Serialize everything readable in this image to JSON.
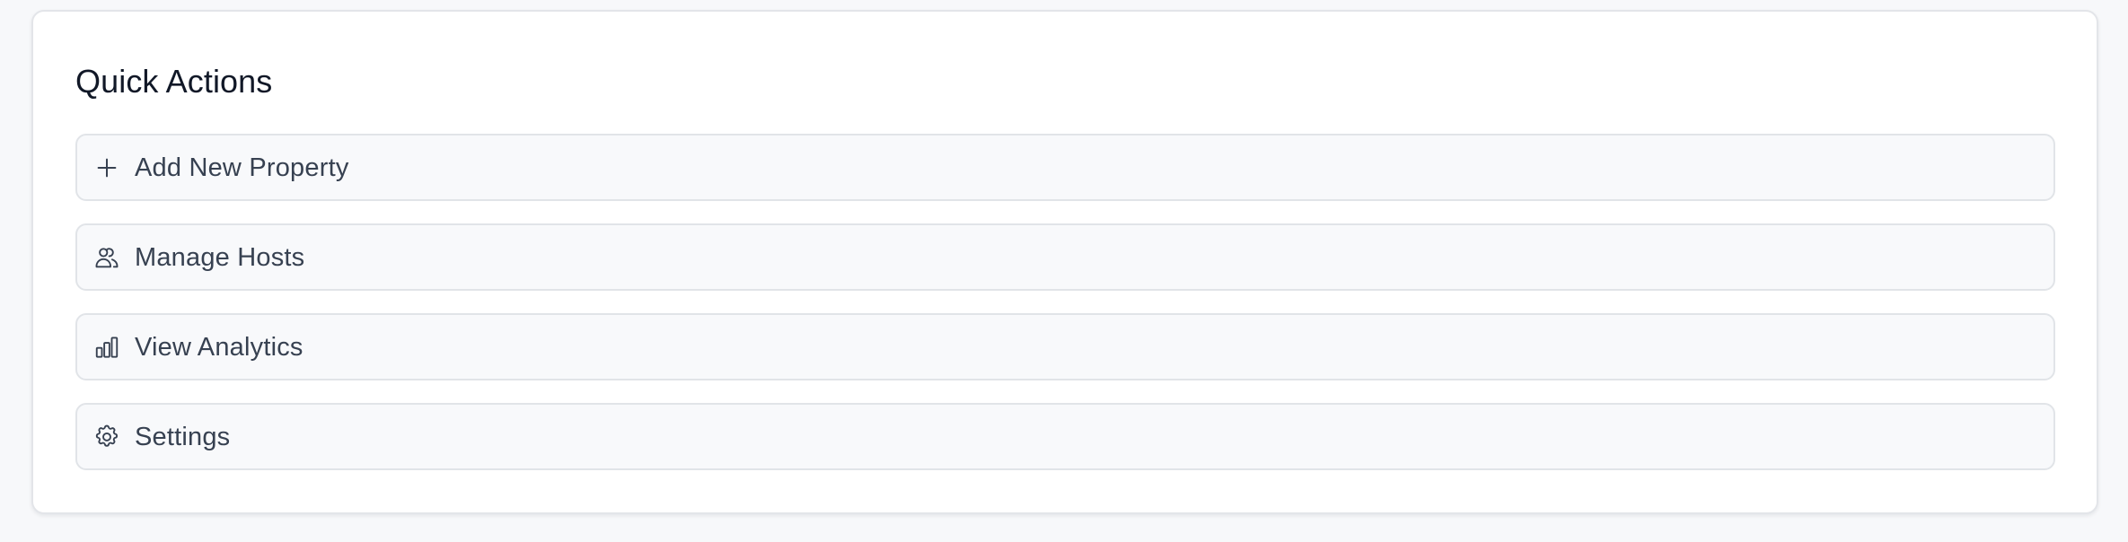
{
  "quick_actions": {
    "title": "Quick Actions",
    "items": [
      {
        "label": "Add New Property",
        "icon": "plus-icon"
      },
      {
        "label": "Manage Hosts",
        "icon": "users-icon"
      },
      {
        "label": "View Analytics",
        "icon": "bar-chart-icon"
      },
      {
        "label": "Settings",
        "icon": "gear-icon"
      }
    ]
  }
}
